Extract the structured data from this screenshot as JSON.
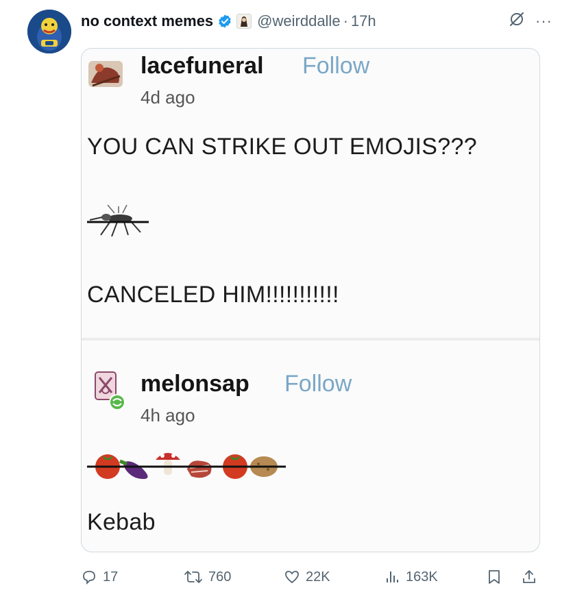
{
  "tweet": {
    "display_name": "no context memes",
    "handle": "@weirddalle",
    "separator": "·",
    "time": "17h",
    "more": "···"
  },
  "media": {
    "post1": {
      "user": "lacefuneral",
      "follow": "Follow",
      "ago": "4d ago",
      "text1": "YOU CAN STRIKE OUT EMOJIS???",
      "text2": "CANCELED HIM!!!!!!!!!!!"
    },
    "post2": {
      "user": "melonsap",
      "follow": "Follow",
      "ago": "4h ago",
      "text": "Kebab"
    }
  },
  "actions": {
    "replies": "17",
    "reposts": "760",
    "likes": "22K",
    "views": "163K"
  },
  "colors": {
    "verified": "#1d9bf0",
    "follow": "#7aa7c7",
    "muted": "#536471"
  }
}
